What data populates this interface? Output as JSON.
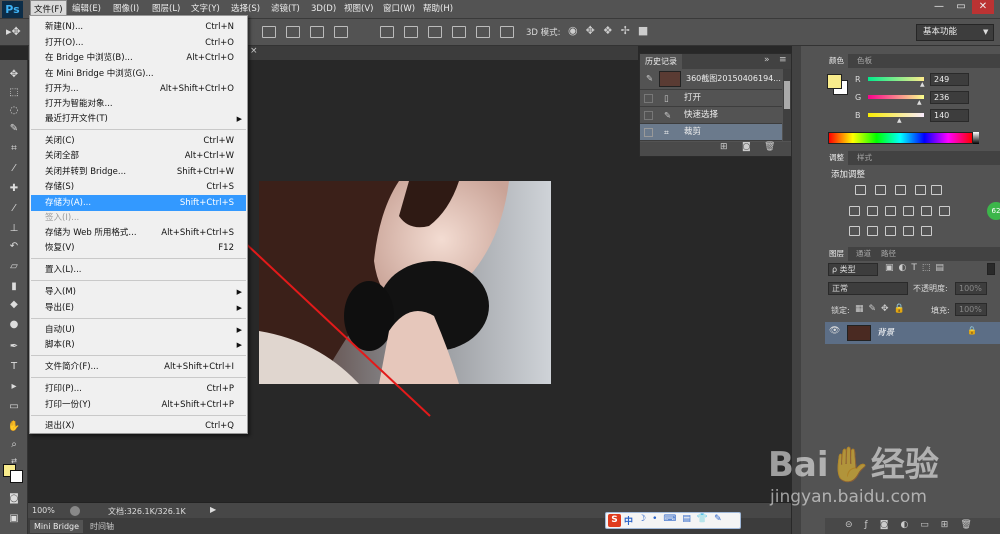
{
  "app": {
    "logo": "Ps"
  },
  "menubar": {
    "items": [
      "文件(F)",
      "编辑(E)",
      "图像(I)",
      "图层(L)",
      "文字(Y)",
      "选择(S)",
      "滤镜(T)",
      "3D(D)",
      "视图(V)",
      "窗口(W)",
      "帮助(H)"
    ],
    "active_index": 0,
    "window_buttons": [
      "—",
      "▭",
      "✕"
    ]
  },
  "optionsbar": {
    "mode_label": "3D 模式:",
    "workspace": "基本功能"
  },
  "file_menu": {
    "items": [
      {
        "label": "新建(N)...",
        "shortcut": "Ctrl+N"
      },
      {
        "label": "打开(O)...",
        "shortcut": "Ctrl+O"
      },
      {
        "label": "在 Bridge 中浏览(B)...",
        "shortcut": "Alt+Ctrl+O"
      },
      {
        "label": "在 Mini Bridge 中浏览(G)...",
        "shortcut": ""
      },
      {
        "label": "打开为...",
        "shortcut": "Alt+Shift+Ctrl+O"
      },
      {
        "label": "打开为智能对象...",
        "shortcut": ""
      },
      {
        "label": "最近打开文件(T)",
        "shortcut": "",
        "submenu": true
      },
      {
        "label": "关闭(C)",
        "shortcut": "Ctrl+W"
      },
      {
        "label": "关闭全部",
        "shortcut": "Alt+Ctrl+W"
      },
      {
        "label": "关闭并转到 Bridge...",
        "shortcut": "Shift+Ctrl+W"
      },
      {
        "label": "存储(S)",
        "shortcut": "Ctrl+S"
      },
      {
        "label": "存储为(A)...",
        "shortcut": "Shift+Ctrl+S",
        "highlighted": true
      },
      {
        "label": "签入(I)...",
        "shortcut": "",
        "disabled": true
      },
      {
        "label": "存储为 Web 所用格式...",
        "shortcut": "Alt+Shift+Ctrl+S"
      },
      {
        "label": "恢复(V)",
        "shortcut": "F12"
      },
      {
        "label": "置入(L)...",
        "shortcut": ""
      },
      {
        "label": "导入(M)",
        "shortcut": "",
        "submenu": true
      },
      {
        "label": "导出(E)",
        "shortcut": "",
        "submenu": true
      },
      {
        "label": "自动(U)",
        "shortcut": "",
        "submenu": true
      },
      {
        "label": "脚本(R)",
        "shortcut": "",
        "submenu": true
      },
      {
        "label": "文件简介(F)...",
        "shortcut": "Alt+Shift+Ctrl+I"
      },
      {
        "label": "打印(P)...",
        "shortcut": "Ctrl+P"
      },
      {
        "label": "打印一份(Y)",
        "shortcut": "Alt+Shift+Ctrl+P"
      },
      {
        "label": "退出(X)",
        "shortcut": "Ctrl+Q"
      }
    ]
  },
  "history_panel": {
    "tab": "历史记录",
    "snapshot": "360截图20150406194...",
    "states": [
      "打开",
      "快速选择",
      "裁剪"
    ],
    "selected_index": 2
  },
  "color_panel": {
    "tabs": [
      "颜色",
      "色板"
    ],
    "r": "249",
    "g": "236",
    "b": "140",
    "r_label": "R",
    "g_label": "G",
    "b_label": "B",
    "fg": "#f9ec8c"
  },
  "adjustments_panel": {
    "tabs": [
      "调整",
      "样式"
    ],
    "title": "添加调整"
  },
  "layers_panel": {
    "tabs": [
      "图层",
      "通道",
      "路径"
    ],
    "filter": "ρ 类型",
    "blend_mode": "正常",
    "opacity_label": "不透明度:",
    "opacity": "100%",
    "lock_label": "锁定:",
    "fill_label": "填充:",
    "fill": "100%",
    "layer_name": "背景"
  },
  "status": {
    "zoom": "100%",
    "doc": "文档:326.1K/326.1K"
  },
  "bottom_tabs": [
    "Mini Bridge",
    "时间轴"
  ],
  "badge": "62",
  "watermark": {
    "brand": "Bai",
    "suffix": "经验",
    "url": "jingyan.baidu.com"
  },
  "ime": {
    "label": "中"
  },
  "colors": {
    "accent": "#3399ff",
    "arrow": "#e31a1a",
    "ps_blue": "#3fb3f5"
  }
}
